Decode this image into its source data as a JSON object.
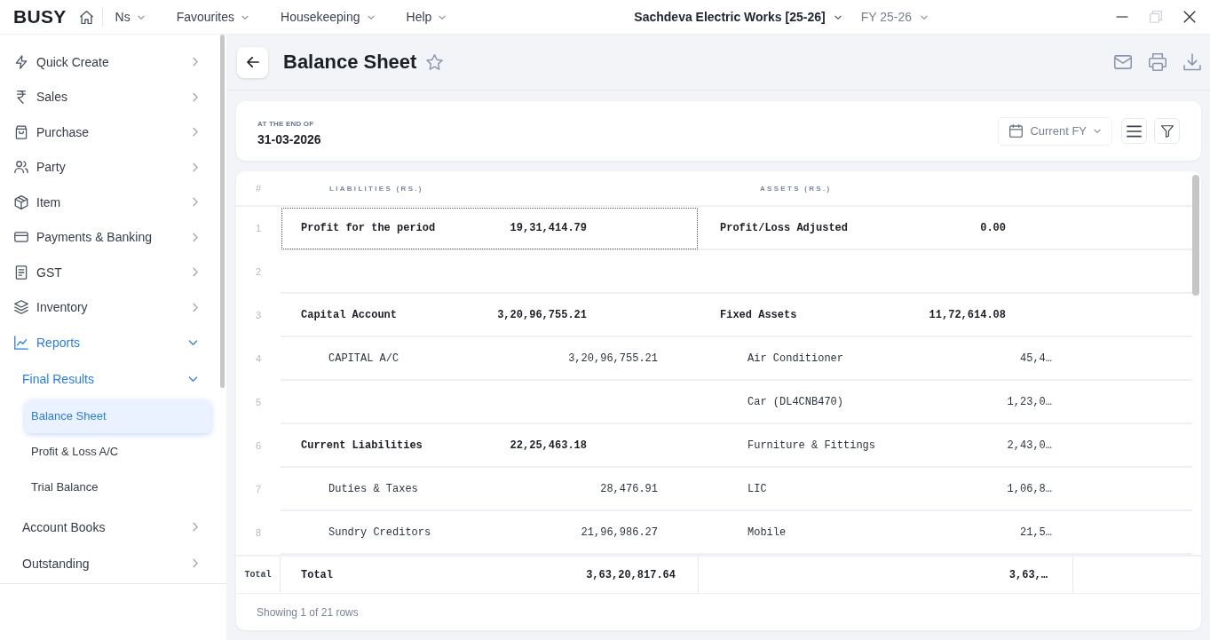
{
  "top_bar": {
    "logo": "BUSY",
    "menus": [
      {
        "label": "Ns"
      },
      {
        "label": "Favourites"
      },
      {
        "label": "Housekeeping"
      },
      {
        "label": "Help"
      }
    ],
    "company": "Sachdeva Electric Works [25-26]",
    "fiscal_year": "FY 25-26",
    "window_controls": [
      {
        "kind": "minimize",
        "disabled": false
      },
      {
        "kind": "restore",
        "disabled": true
      },
      {
        "kind": "close",
        "disabled": false
      }
    ]
  },
  "sidebar": {
    "items": [
      {
        "label": "Quick Create",
        "selected": false,
        "expanded": false
      },
      {
        "label": "Sales",
        "selected": false,
        "expanded": false
      },
      {
        "label": "Purchase",
        "selected": false,
        "expanded": false
      },
      {
        "label": "Party",
        "selected": false,
        "expanded": false
      },
      {
        "label": "Item",
        "selected": false,
        "expanded": false
      },
      {
        "label": "Payments & Banking",
        "selected": false,
        "expanded": false
      },
      {
        "label": "GST",
        "selected": false,
        "expanded": false
      },
      {
        "label": "Inventory",
        "selected": false,
        "expanded": false
      },
      {
        "label": "Reports",
        "selected": true,
        "expanded": true,
        "children": [
          {
            "label": "Final Results",
            "selected": true,
            "expanded": true,
            "children": [
              {
                "label": "Balance Sheet",
                "selected": true
              },
              {
                "label": "Profit & Loss A/C",
                "selected": false
              },
              {
                "label": "Trial Balance",
                "selected": false
              }
            ]
          },
          {
            "label": "Account Books",
            "selected": false,
            "expanded": false
          },
          {
            "label": "Outstanding",
            "selected": false,
            "expanded": false
          }
        ]
      }
    ]
  },
  "page_header": {
    "title": "Balance Sheet",
    "starred": false
  },
  "filter_card": {
    "caption": "AT THE END OF",
    "date": "31-03-2026",
    "period": "Current FY"
  },
  "table": {
    "columns": [
      "#",
      "LIABILITIES (RS.)",
      "ASSETS (RS.)"
    ],
    "rows": [
      {
        "number": "1",
        "selected": true,
        "liability": {
          "kind": "group",
          "name": "Profit for the period",
          "amount": "19,31,414.79"
        },
        "asset": {
          "kind": "group",
          "name": "Profit/Loss Adjusted",
          "amount": "0.00"
        }
      },
      {
        "number": "2",
        "selected": false
      },
      {
        "number": "3",
        "selected": false,
        "liability": {
          "kind": "group",
          "name": "Capital Account",
          "amount": "3,20,96,755.21"
        },
        "asset": {
          "kind": "group",
          "name": "Fixed Assets",
          "amount": "11,72,614.08"
        }
      },
      {
        "number": "4",
        "selected": false,
        "liability": {
          "kind": "item",
          "name": "CAPITAL A/C",
          "amount": "3,20,96,755.21"
        },
        "asset": {
          "kind": "item",
          "name": "Air Conditioner",
          "amount": "45,4…"
        }
      },
      {
        "number": "5",
        "selected": false,
        "asset": {
          "kind": "item",
          "name": "Car (DL4CNB470)",
          "amount": "1,23,0…"
        }
      },
      {
        "number": "6",
        "selected": false,
        "liability": {
          "kind": "group",
          "name": "Current Liabilities",
          "amount": "22,25,463.18"
        },
        "asset": {
          "kind": "item",
          "name": "Furniture & Fittings",
          "amount": "2,43,0…"
        }
      },
      {
        "number": "7",
        "selected": false,
        "liability": {
          "kind": "item",
          "name": "Duties & Taxes",
          "amount": "28,476.91"
        },
        "asset": {
          "kind": "item",
          "name": "LIC",
          "amount": "1,06,8…"
        }
      },
      {
        "number": "8",
        "selected": false,
        "liability": {
          "kind": "item",
          "name": "Sundry Creditors",
          "amount": "21,96,986.27"
        },
        "asset": {
          "kind": "item",
          "name": "Mobile",
          "amount": "21,5…"
        }
      }
    ],
    "total": {
      "label": "Total",
      "liability_label": "Total",
      "liability_amount": "3,63,20,817.64",
      "asset_amount": "3,63,…"
    },
    "footer": "Showing 1 of 21 rows"
  }
}
